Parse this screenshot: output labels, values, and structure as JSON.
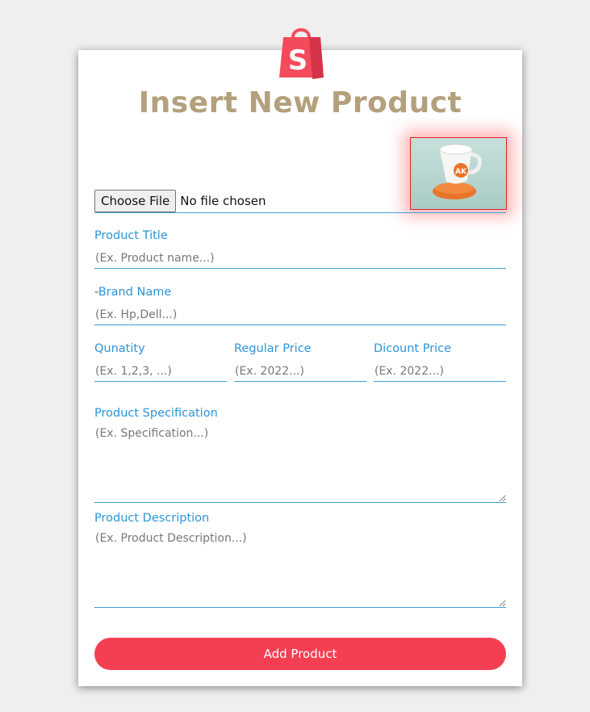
{
  "logo": {
    "icon": "shopping-bag-icon",
    "letter": "S",
    "color": "#f44b5c"
  },
  "heading": {
    "title": "Insert New Product"
  },
  "image_upload": {
    "button_label": "Choose File",
    "status": "No file chosen",
    "preview_logo_text": "AK"
  },
  "fields": {
    "product_title": {
      "label": "Product Title",
      "placeholder": "(Ex. Product name...)"
    },
    "brand_name": {
      "prefix": "-",
      "label": "Brand Name",
      "placeholder": "(Ex. Hp,Dell...)"
    },
    "quantity": {
      "label": "Qunatity",
      "placeholder": "(Ex. 1,2,3, ...)"
    },
    "regular_price": {
      "label": "Regular Price",
      "placeholder": "(Ex. 2022...)"
    },
    "discount_price": {
      "label": "Dicount Price",
      "placeholder": "(Ex. 2022...)"
    },
    "specification": {
      "label": "Product Specification",
      "placeholder": "(Ex. Specification...)"
    },
    "description": {
      "label": "Product Description",
      "placeholder": "(Ex. Product Description...)"
    }
  },
  "submit": {
    "label": "Add Product"
  },
  "colors": {
    "accent": "#2b95d6",
    "title": "#b3a07c",
    "button": "#f43f53",
    "preview_border": "#e0202c"
  }
}
